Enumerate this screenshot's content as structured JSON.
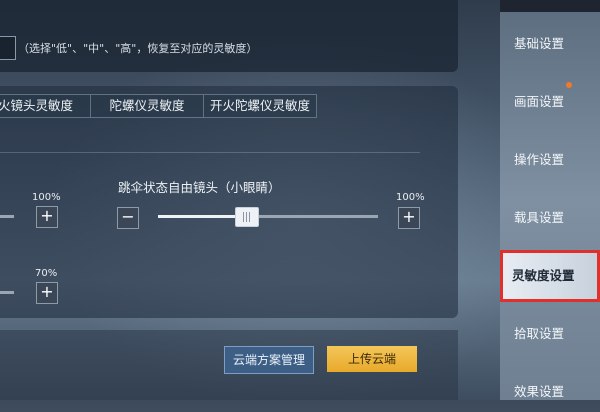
{
  "top": {
    "hint": "（选择\"低\"、\"中\"、\"高\"，恢复至对应的灵敏度）"
  },
  "tabs": [
    {
      "label": "火镜头灵敏度"
    },
    {
      "label": "陀螺仪灵敏度"
    },
    {
      "label": "开火陀螺仪灵敏度"
    }
  ],
  "settings": {
    "left_row1_percent": "100%",
    "left_row2_percent": "70%",
    "parachute": {
      "label": "跳伞状态自由镜头（小眼睛）",
      "percent": "100%",
      "level": 0.4
    },
    "plus": "+",
    "minus": "−"
  },
  "buttons": {
    "cloud_manage": "云端方案管理",
    "upload": "上传云端"
  },
  "sidebar": {
    "items": [
      {
        "label": "基础设置"
      },
      {
        "label": "画面设置"
      },
      {
        "label": "操作设置"
      },
      {
        "label": "载具设置"
      },
      {
        "label": "灵敏度设置"
      },
      {
        "label": "拾取设置"
      },
      {
        "label": "效果设置"
      }
    ],
    "active_index": 4
  },
  "colors": {
    "accent_gold": "#f0b840",
    "active_outline": "#e0302c",
    "notify_dot": "#f07a2a"
  }
}
